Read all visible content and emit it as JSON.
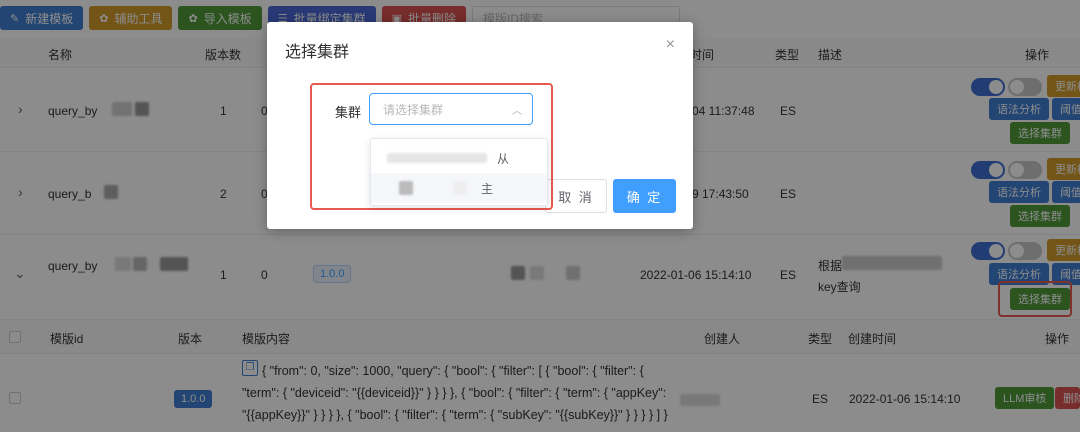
{
  "toolbar": {
    "buttons": [
      {
        "label": "新建模板",
        "icon": "edit-icon",
        "color": "#3f7fd1"
      },
      {
        "label": "辅助工具",
        "icon": "gear-icon",
        "color": "#d19b2b"
      },
      {
        "label": "导入模板",
        "icon": "gear-icon",
        "color": "#4f9a39"
      },
      {
        "label": "批量绑定集群",
        "icon": "list-icon",
        "color": "#4a68d8"
      },
      {
        "label": "批量删除",
        "icon": "trash-icon",
        "color": "#d9534f"
      }
    ],
    "search_placeholder": "模版ID搜索"
  },
  "main_table": {
    "headers": {
      "name": "名称",
      "versions": "版本数",
      "time": "时间",
      "type": "类型",
      "desc": "描述",
      "ops": "操作"
    },
    "rows": [
      {
        "name": "query_by",
        "versions": "1",
        "count": "0",
        "time": "04 11:37:48",
        "type": "ES",
        "desc": "",
        "expand": "›"
      },
      {
        "name": "query_b",
        "versions": "2",
        "count": "0",
        "time": "9 17:43:50",
        "type": "ES",
        "desc": "",
        "expand": "›"
      },
      {
        "name": "query_by",
        "versions": "1",
        "count": "0",
        "version_tag": "1.0.0",
        "time": "2022-01-06 15:14:10",
        "type": "ES",
        "desc_line1": "根据",
        "desc_line2": "key查询",
        "expand": "⌄"
      }
    ],
    "op_buttons": {
      "update": "更新模",
      "analyze": "语法分析",
      "threshold": "阈值",
      "select_cluster": "选择集群"
    }
  },
  "sub_table": {
    "headers": {
      "id": "模版id",
      "version": "版本",
      "content": "模版内容",
      "creator": "创建人",
      "type": "类型",
      "created": "创建时间",
      "ops": "操作"
    },
    "row": {
      "version": "1.0.0",
      "content": "{ \"from\": 0, \"size\": 1000, \"query\": { \"bool\": { \"filter\": [ { \"bool\": { \"filter\": { \"term\": { \"deviceid\": \"{{deviceid}}\" } } } }, { \"bool\": { \"filter\": { \"term\": { \"appKey\": \"{{appKey}}\" } } } }, { \"bool\": { \"filter\": { \"term\": { \"subKey\": \"{{subKey}}\" } } } } ] } } }",
      "type": "ES",
      "created": "2022-01-06 15:14:10",
      "llm_btn": "LLM审核",
      "del_btn": "删除"
    }
  },
  "dialog": {
    "title": "选择集群",
    "close": "×",
    "field_label": "集群",
    "select_placeholder": "请选择集群",
    "options": [
      "从",
      "主"
    ],
    "cancel": "取 消",
    "confirm": "确 定"
  }
}
